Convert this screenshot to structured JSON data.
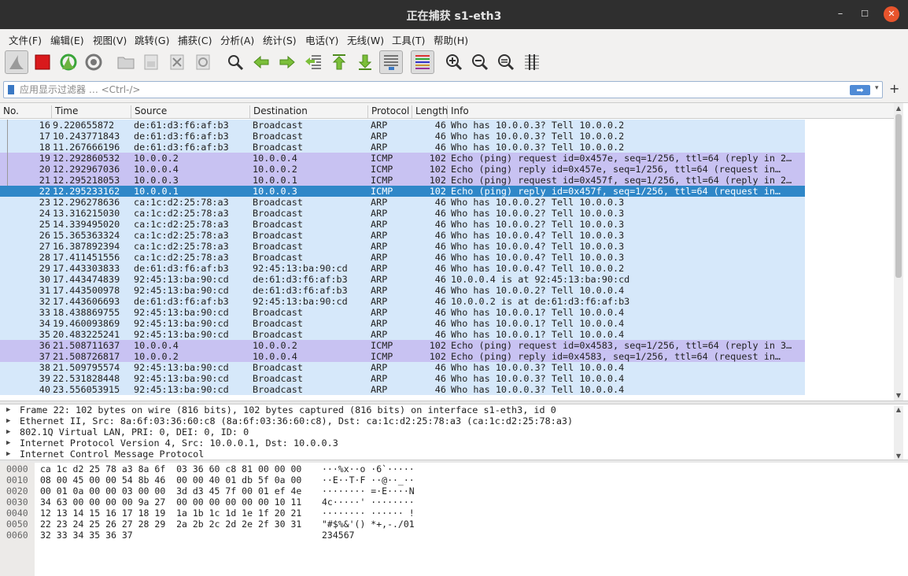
{
  "window": {
    "title": "正在捕获 s1-eth3",
    "min": "–",
    "max": "☐",
    "close": "✕"
  },
  "menu": [
    "文件(F)",
    "编辑(E)",
    "视图(V)",
    "跳转(G)",
    "捕获(C)",
    "分析(A)",
    "统计(S)",
    "电话(Y)",
    "无线(W)",
    "工具(T)",
    "帮助(H)"
  ],
  "filter": {
    "placeholder": "应用显示过滤器 … <Ctrl-/>",
    "value": "",
    "apply": "➡",
    "dropdown": "▾",
    "add": "+"
  },
  "columns": [
    "No.",
    "Time",
    "Source",
    "Destination",
    "Protocol",
    "Length",
    "Info"
  ],
  "packets": [
    {
      "no": "16",
      "time": "9.220655872",
      "src": "de:61:d3:f6:af:b3",
      "dst": "Broadcast",
      "proto": "ARP",
      "len": "46",
      "info": "Who has 10.0.0.3? Tell 10.0.0.2",
      "cls": "arp"
    },
    {
      "no": "17",
      "time": "10.243771843",
      "src": "de:61:d3:f6:af:b3",
      "dst": "Broadcast",
      "proto": "ARP",
      "len": "46",
      "info": "Who has 10.0.0.3? Tell 10.0.0.2",
      "cls": "arp"
    },
    {
      "no": "18",
      "time": "11.267666196",
      "src": "de:61:d3:f6:af:b3",
      "dst": "Broadcast",
      "proto": "ARP",
      "len": "46",
      "info": "Who has 10.0.0.3? Tell 10.0.0.2",
      "cls": "arp"
    },
    {
      "no": "19",
      "time": "12.292860532",
      "src": "10.0.0.2",
      "dst": "10.0.0.4",
      "proto": "ICMP",
      "len": "102",
      "info": "Echo (ping) request  id=0x457e, seq=1/256, ttl=64 (reply in 2…",
      "cls": "icmp"
    },
    {
      "no": "20",
      "time": "12.292967036",
      "src": "10.0.0.4",
      "dst": "10.0.0.2",
      "proto": "ICMP",
      "len": "102",
      "info": "Echo (ping) reply    id=0x457e, seq=1/256, ttl=64 (request in…",
      "cls": "icmp"
    },
    {
      "no": "21",
      "time": "12.295218053",
      "src": "10.0.0.3",
      "dst": "10.0.0.1",
      "proto": "ICMP",
      "len": "102",
      "info": "Echo (ping) request  id=0x457f, seq=1/256, ttl=64 (reply in 2…",
      "cls": "icmp"
    },
    {
      "no": "22",
      "time": "12.295233162",
      "src": "10.0.0.1",
      "dst": "10.0.0.3",
      "proto": "ICMP",
      "len": "102",
      "info": "Echo (ping) reply    id=0x457f, seq=1/256, ttl=64 (request in…",
      "cls": "sel"
    },
    {
      "no": "23",
      "time": "12.296278636",
      "src": "ca:1c:d2:25:78:a3",
      "dst": "Broadcast",
      "proto": "ARP",
      "len": "46",
      "info": "Who has 10.0.0.2? Tell 10.0.0.3",
      "cls": "arp"
    },
    {
      "no": "24",
      "time": "13.316215030",
      "src": "ca:1c:d2:25:78:a3",
      "dst": "Broadcast",
      "proto": "ARP",
      "len": "46",
      "info": "Who has 10.0.0.2? Tell 10.0.0.3",
      "cls": "arp"
    },
    {
      "no": "25",
      "time": "14.339495020",
      "src": "ca:1c:d2:25:78:a3",
      "dst": "Broadcast",
      "proto": "ARP",
      "len": "46",
      "info": "Who has 10.0.0.2? Tell 10.0.0.3",
      "cls": "arp"
    },
    {
      "no": "26",
      "time": "15.365363324",
      "src": "ca:1c:d2:25:78:a3",
      "dst": "Broadcast",
      "proto": "ARP",
      "len": "46",
      "info": "Who has 10.0.0.4? Tell 10.0.0.3",
      "cls": "arp"
    },
    {
      "no": "27",
      "time": "16.387892394",
      "src": "ca:1c:d2:25:78:a3",
      "dst": "Broadcast",
      "proto": "ARP",
      "len": "46",
      "info": "Who has 10.0.0.4? Tell 10.0.0.3",
      "cls": "arp"
    },
    {
      "no": "28",
      "time": "17.411451556",
      "src": "ca:1c:d2:25:78:a3",
      "dst": "Broadcast",
      "proto": "ARP",
      "len": "46",
      "info": "Who has 10.0.0.4? Tell 10.0.0.3",
      "cls": "arp"
    },
    {
      "no": "29",
      "time": "17.443303833",
      "src": "de:61:d3:f6:af:b3",
      "dst": "92:45:13:ba:90:cd",
      "proto": "ARP",
      "len": "46",
      "info": "Who has 10.0.0.4? Tell 10.0.0.2",
      "cls": "arp"
    },
    {
      "no": "30",
      "time": "17.443474839",
      "src": "92:45:13:ba:90:cd",
      "dst": "de:61:d3:f6:af:b3",
      "proto": "ARP",
      "len": "46",
      "info": "10.0.0.4 is at 92:45:13:ba:90:cd",
      "cls": "arp"
    },
    {
      "no": "31",
      "time": "17.443500978",
      "src": "92:45:13:ba:90:cd",
      "dst": "de:61:d3:f6:af:b3",
      "proto": "ARP",
      "len": "46",
      "info": "Who has 10.0.0.2? Tell 10.0.0.4",
      "cls": "arp"
    },
    {
      "no": "32",
      "time": "17.443606693",
      "src": "de:61:d3:f6:af:b3",
      "dst": "92:45:13:ba:90:cd",
      "proto": "ARP",
      "len": "46",
      "info": "10.0.0.2 is at de:61:d3:f6:af:b3",
      "cls": "arp"
    },
    {
      "no": "33",
      "time": "18.438869755",
      "src": "92:45:13:ba:90:cd",
      "dst": "Broadcast",
      "proto": "ARP",
      "len": "46",
      "info": "Who has 10.0.0.1? Tell 10.0.0.4",
      "cls": "arp"
    },
    {
      "no": "34",
      "time": "19.460093869",
      "src": "92:45:13:ba:90:cd",
      "dst": "Broadcast",
      "proto": "ARP",
      "len": "46",
      "info": "Who has 10.0.0.1? Tell 10.0.0.4",
      "cls": "arp"
    },
    {
      "no": "35",
      "time": "20.483225241",
      "src": "92:45:13:ba:90:cd",
      "dst": "Broadcast",
      "proto": "ARP",
      "len": "46",
      "info": "Who has 10.0.0.1? Tell 10.0.0.4",
      "cls": "arp"
    },
    {
      "no": "36",
      "time": "21.508711637",
      "src": "10.0.0.4",
      "dst": "10.0.0.2",
      "proto": "ICMP",
      "len": "102",
      "info": "Echo (ping) request  id=0x4583, seq=1/256, ttl=64 (reply in 3…",
      "cls": "icmp"
    },
    {
      "no": "37",
      "time": "21.508726817",
      "src": "10.0.0.2",
      "dst": "10.0.0.4",
      "proto": "ICMP",
      "len": "102",
      "info": "Echo (ping) reply    id=0x4583, seq=1/256, ttl=64 (request in…",
      "cls": "icmp"
    },
    {
      "no": "38",
      "time": "21.509795574",
      "src": "92:45:13:ba:90:cd",
      "dst": "Broadcast",
      "proto": "ARP",
      "len": "46",
      "info": "Who has 10.0.0.3? Tell 10.0.0.4",
      "cls": "arp"
    },
    {
      "no": "39",
      "time": "22.531828448",
      "src": "92:45:13:ba:90:cd",
      "dst": "Broadcast",
      "proto": "ARP",
      "len": "46",
      "info": "Who has 10.0.0.3? Tell 10.0.0.4",
      "cls": "arp"
    },
    {
      "no": "40",
      "time": "23.556053915",
      "src": "92:45:13:ba:90:cd",
      "dst": "Broadcast",
      "proto": "ARP",
      "len": "46",
      "info": "Who has 10.0.0.3? Tell 10.0.0.4",
      "cls": "arp"
    }
  ],
  "details": [
    "Frame 22: 102 bytes on wire (816 bits), 102 bytes captured (816 bits) on interface s1-eth3, id 0",
    "Ethernet II, Src: 8a:6f:03:36:60:c8 (8a:6f:03:36:60:c8), Dst: ca:1c:d2:25:78:a3 (ca:1c:d2:25:78:a3)",
    "802.1Q Virtual LAN, PRI: 0, DEI: 0, ID: 0",
    "Internet Protocol Version 4, Src: 10.0.0.1, Dst: 10.0.0.3",
    "Internet Control Message Protocol"
  ],
  "bytes": [
    {
      "off": "0000",
      "hex": "ca 1c d2 25 78 a3 8a 6f  03 36 60 c8 81 00 00 00",
      "asc": "···%x··o ·6`·····"
    },
    {
      "off": "0010",
      "hex": "08 00 45 00 00 54 8b 46  00 00 40 01 db 5f 0a 00",
      "asc": "··E··T·F ··@··_··"
    },
    {
      "off": "0020",
      "hex": "00 01 0a 00 00 03 00 00  3d d3 45 7f 00 01 ef 4e",
      "asc": "········ =·E····N"
    },
    {
      "off": "0030",
      "hex": "34 63 00 00 00 00 9a 27  00 00 00 00 00 00 10 11",
      "asc": "4c·····' ········"
    },
    {
      "off": "0040",
      "hex": "12 13 14 15 16 17 18 19  1a 1b 1c 1d 1e 1f 20 21",
      "asc": "········ ······ !"
    },
    {
      "off": "0050",
      "hex": "22 23 24 25 26 27 28 29  2a 2b 2c 2d 2e 2f 30 31",
      "asc": "\"#$%&'() *+,-./01"
    },
    {
      "off": "0060",
      "hex": "32 33 34 35 36 37",
      "asc": "234567"
    }
  ],
  "colors": {
    "arp": "#d6e8fa",
    "icmp": "#c8c2f2",
    "selected": "#2f87c8",
    "titlebar": "#2f2f2f"
  }
}
